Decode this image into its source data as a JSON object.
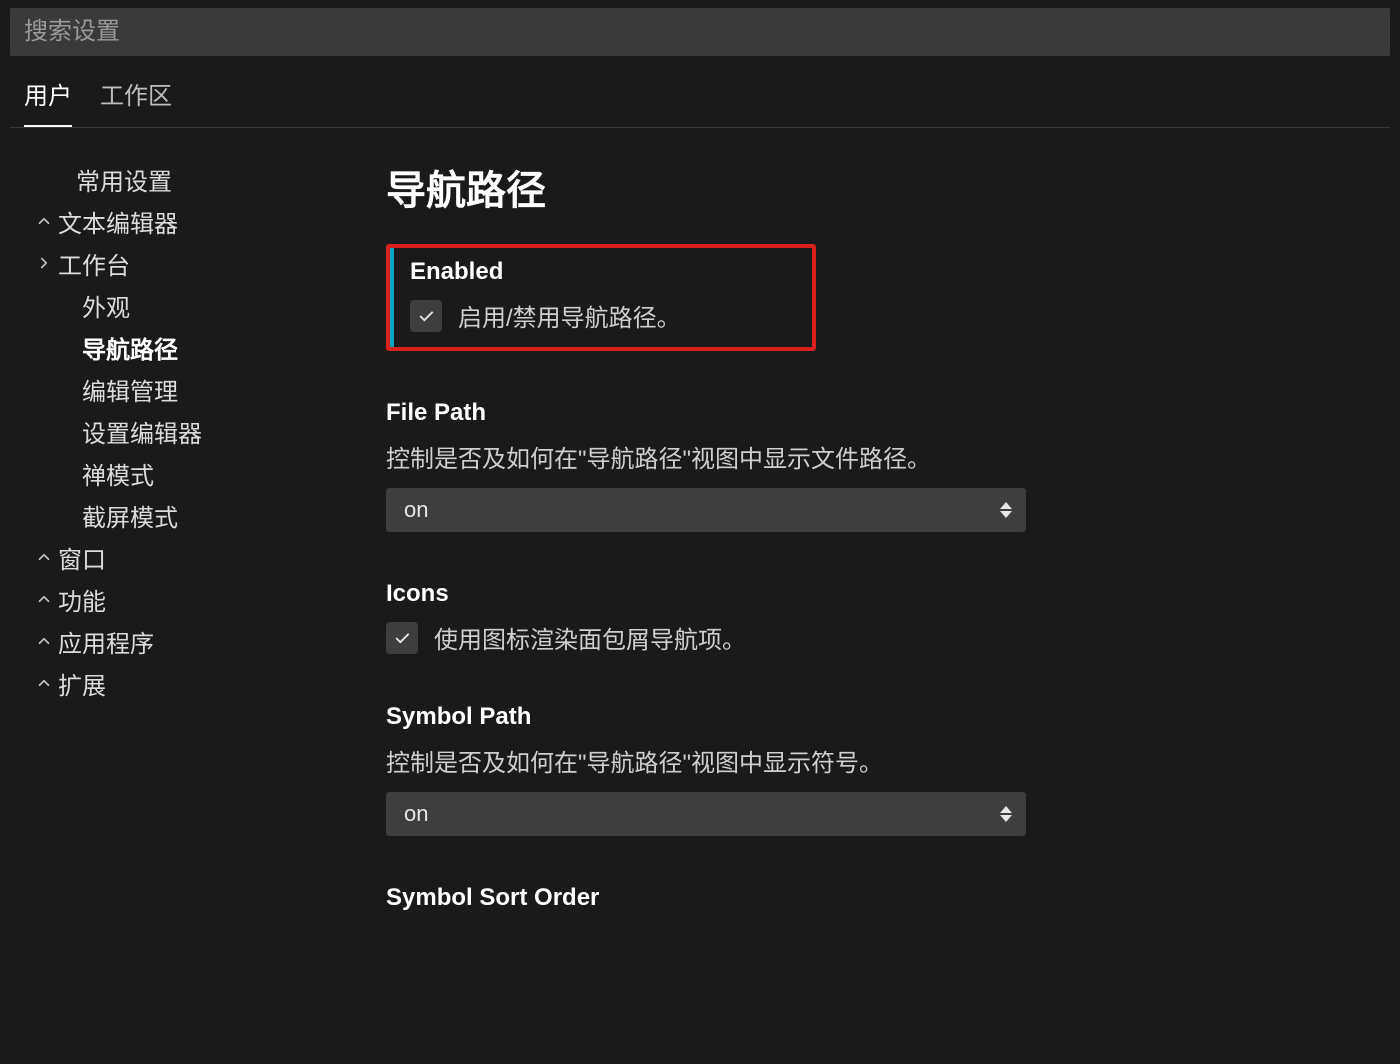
{
  "search": {
    "placeholder": "搜索设置",
    "value": ""
  },
  "tabs": {
    "user": "用户",
    "workspace": "工作区",
    "active": "user"
  },
  "sidebar": {
    "items": [
      {
        "label": "常用设置",
        "level": 0,
        "icon": "none"
      },
      {
        "label": "文本编辑器",
        "level": 0,
        "icon": "chevron-up"
      },
      {
        "label": "工作台",
        "level": 0,
        "icon": "chevron-right"
      },
      {
        "label": "外观",
        "level": 1
      },
      {
        "label": "导航路径",
        "level": 1,
        "active": true
      },
      {
        "label": "编辑管理",
        "level": 1
      },
      {
        "label": "设置编辑器",
        "level": 1
      },
      {
        "label": "禅模式",
        "level": 1
      },
      {
        "label": "截屏模式",
        "level": 1
      },
      {
        "label": "窗口",
        "level": 0,
        "icon": "chevron-up"
      },
      {
        "label": "功能",
        "level": 0,
        "icon": "chevron-up"
      },
      {
        "label": "应用程序",
        "level": 0,
        "icon": "chevron-up"
      },
      {
        "label": "扩展",
        "level": 0,
        "icon": "chevron-up"
      }
    ]
  },
  "section": {
    "title": "导航路径"
  },
  "settings": {
    "enabled": {
      "title": "Enabled",
      "desc": "启用/禁用导航路径。",
      "checked": true
    },
    "filePath": {
      "title": "File Path",
      "desc": "控制是否及如何在\"导航路径\"视图中显示文件路径。",
      "value": "on"
    },
    "icons": {
      "title": "Icons",
      "desc": "使用图标渲染面包屑导航项。",
      "checked": true
    },
    "symbolPath": {
      "title": "Symbol Path",
      "desc": "控制是否及如何在\"导航路径\"视图中显示符号。",
      "value": "on"
    },
    "symbolSortOrder": {
      "title": "Symbol Sort Order"
    }
  }
}
